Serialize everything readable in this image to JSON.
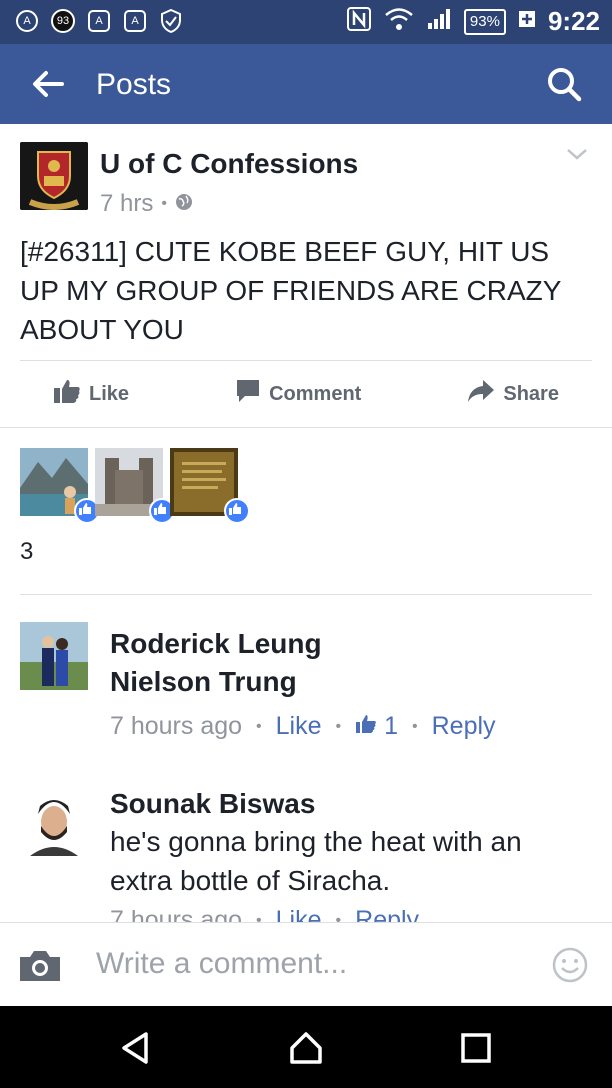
{
  "status_bar": {
    "notification_count": "93",
    "battery": "93%",
    "time": "9:22"
  },
  "app_bar": {
    "title": "Posts"
  },
  "post": {
    "author": "U of C Confessions",
    "time": "7 hrs",
    "text": "[#26311] CUTE KOBE BEEF GUY, HIT US UP MY GROUP OF FRIENDS ARE CRAZY ABOUT YOU",
    "actions": {
      "like": "Like",
      "comment": "Comment",
      "share": "Share"
    },
    "like_count": "3"
  },
  "comments": [
    {
      "name": "Roderick Leung",
      "mention": "Nielson Trung",
      "time": "7 hours ago",
      "like_label": "Like",
      "likes": "1",
      "reply_label": "Reply"
    },
    {
      "name": "Sounak Biswas",
      "text": "he's gonna bring the heat with an extra bottle of Siracha.",
      "time": "7 hours ago",
      "like_label": "Like",
      "reply_label": "Reply"
    }
  ],
  "composer": {
    "placeholder": "Write a comment..."
  },
  "colors": {
    "status_bar": "#2d4373",
    "app_bar": "#3b5998",
    "link": "#4b6fb6",
    "meta_gray": "#90949c",
    "like_badge": "#4080ff"
  }
}
